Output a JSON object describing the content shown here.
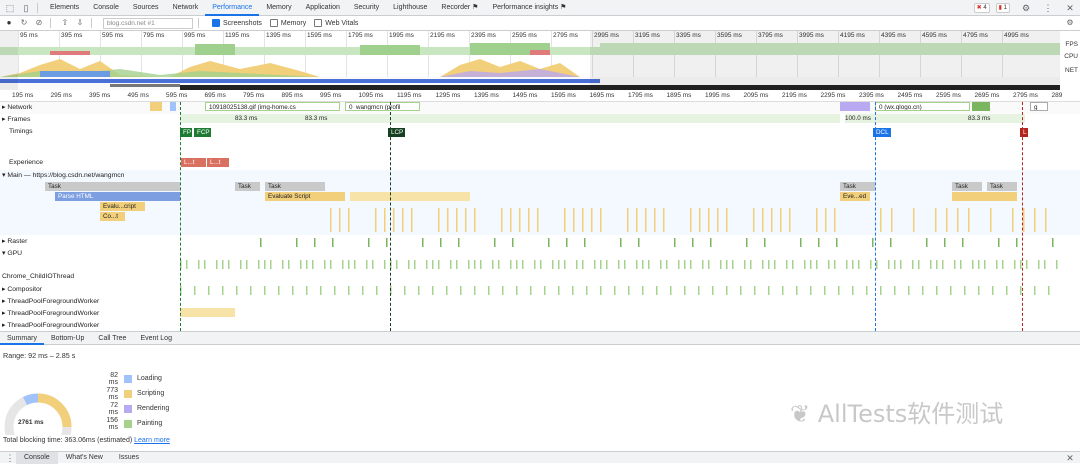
{
  "toolbar_tabs": [
    "Elements",
    "Console",
    "Sources",
    "Network",
    "Performance",
    "Memory",
    "Application",
    "Security",
    "Lighthouse",
    "Recorder ⚑",
    "Performance insights ⚑"
  ],
  "status": {
    "errors": "4",
    "warnings": "1"
  },
  "controls": {
    "url": "blog.csdn.net #1",
    "screenshots": "Screenshots",
    "memory": "Memory",
    "web_vitals": "Web Vitals"
  },
  "overview": {
    "ticks": [
      "95 ms",
      "395 ms",
      "595 ms",
      "795 ms",
      "995 ms",
      "1195 ms",
      "1395 ms",
      "1595 ms",
      "1795 ms",
      "1995 ms",
      "2195 ms",
      "2395 ms",
      "2595 ms",
      "2795 ms",
      "2995 ms",
      "3195 ms",
      "3395 ms",
      "3595 ms",
      "3795 ms",
      "3995 ms",
      "4195 ms",
      "4395 ms",
      "4595 ms",
      "4795 ms",
      "4995 ms"
    ],
    "labels": {
      "fps": "FPS",
      "cpu": "CPU",
      "net": "NET"
    }
  },
  "main_ruler": [
    "195 ms",
    "295 ms",
    "395 ms",
    "495 ms",
    "595 ms",
    "695 ms",
    "795 ms",
    "895 ms",
    "995 ms",
    "1095 ms",
    "1195 ms",
    "1295 ms",
    "1395 ms",
    "1495 ms",
    "1595 ms",
    "1695 ms",
    "1795 ms",
    "1895 ms",
    "1995 ms",
    "2095 ms",
    "2195 ms",
    "2295 ms",
    "2395 ms",
    "2495 ms",
    "2595 ms",
    "2695 ms",
    "2795 ms",
    "289"
  ],
  "tracks": {
    "network": "Network",
    "frames": "Frames",
    "timings": "Timings",
    "experience": "Experience",
    "main": "Main — https://blog.csdn.net/wangmcn",
    "raster": "Raster",
    "gpu": "GPU",
    "child_io": "Chrome_ChildIOThread",
    "compositor": "Compositor",
    "pool1": "ThreadPoolForegroundWorker",
    "pool2": "ThreadPoolForegroundWorker",
    "pool3": "ThreadPoolForegroundWorker"
  },
  "network_bars": {
    "gif": "10918025138.gif (img-home.cs",
    "wangmcn": "0_wangmcn (profil",
    "qlogo": "0 (wx.qlogo.cn)",
    "g": "g"
  },
  "frames": {
    "f1": "83.3 ms",
    "f2": "83.3 ms",
    "f3": "100.0 ms",
    "f4": "83.3 ms"
  },
  "timings": {
    "fp": "FP",
    "fcp": "FCP",
    "lcp": "LCP",
    "dcl": "DCL",
    "l": "L"
  },
  "experience": {
    "e1": "L...t",
    "e2": "L...t"
  },
  "main_bars": {
    "task1": "Task",
    "task2": "Task",
    "task3": "Task",
    "task4": "Task",
    "task5": "Task",
    "task6": "Task",
    "parse": "Parse HTML",
    "evaluate": "Evaluate Script",
    "evalu": "Evalu...cript",
    "co": "Co...t",
    "eveed": "Eve...ed"
  },
  "bottom_tabs": [
    "Summary",
    "Bottom-Up",
    "Call Tree",
    "Event Log"
  ],
  "summary": {
    "range": "Range: 92 ms – 2.85 s",
    "total": "2761 ms",
    "rows": [
      {
        "value": "82 ms",
        "label": "Loading",
        "color": "#a1c2fa"
      },
      {
        "value": "773 ms",
        "label": "Scripting",
        "color": "#f2cf7a"
      },
      {
        "value": "72 ms",
        "label": "Rendering",
        "color": "#b9a9f0"
      },
      {
        "value": "156 ms",
        "label": "Painting",
        "color": "#a4d18c"
      }
    ],
    "blocking": "Total blocking time: 363.06ms (estimated)",
    "learn_more": "Learn more",
    "watermark": "AllTests软件测试"
  },
  "drawer_tabs": [
    "Console",
    "What's New",
    "Issues"
  ]
}
